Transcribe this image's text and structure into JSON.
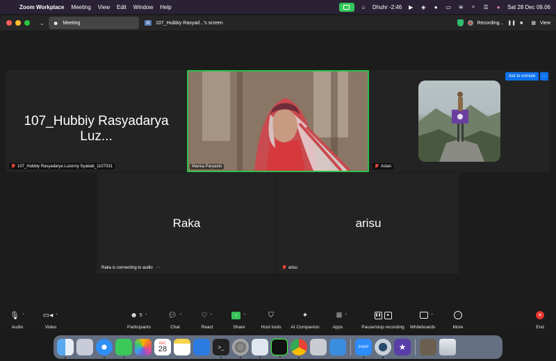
{
  "menubar": {
    "app_name": "Zoom Workplace",
    "menus": [
      "Meeting",
      "View",
      "Edit",
      "Window",
      "Help"
    ],
    "prayer_time": "Dhuhr -2:46",
    "datetime": "Sat 28 Dec  09.06"
  },
  "titlebar": {
    "meeting_tab": "Meeting",
    "screen_tab": "107_Hubbiy Rasyad...'s screen",
    "recording_label": "Recording...",
    "view_label": "View"
  },
  "tiles": {
    "hubbiy_big": "107_Hubbiy Rasyadarya Luz...",
    "hubbiy_tag": "107_Hubbiy Rasyadarya Luzerny Syabab_1107031",
    "marisa_tag": "Marisa Paryasto",
    "aslan_tag": "Aslan",
    "raka_big": "Raka",
    "raka_tag": "Raka is connecting to audio",
    "arisu_big": "arisu",
    "arisu_tag": "arisu"
  },
  "ask_unmute": "Ask to unmute",
  "toolbar": {
    "audio": "Audio",
    "video": "Video",
    "participants": "Participants",
    "participants_count": "5",
    "chat": "Chat",
    "react": "React",
    "share": "Share",
    "host_tools": "Host tools",
    "ai_companion": "AI Companion",
    "apps": "Apps",
    "pause_recording": "Pause/stop recording",
    "whiteboards": "Whiteboards",
    "more": "More",
    "end": "End"
  },
  "dock": {
    "calendar_month": "DEC",
    "calendar_day": "28",
    "zoom_label": "zoom"
  },
  "colors": {
    "active_speaker_border": "#2fbf4b",
    "accent_blue": "#0e72ed",
    "end_red": "#e5372e",
    "share_green": "#35c25b"
  }
}
